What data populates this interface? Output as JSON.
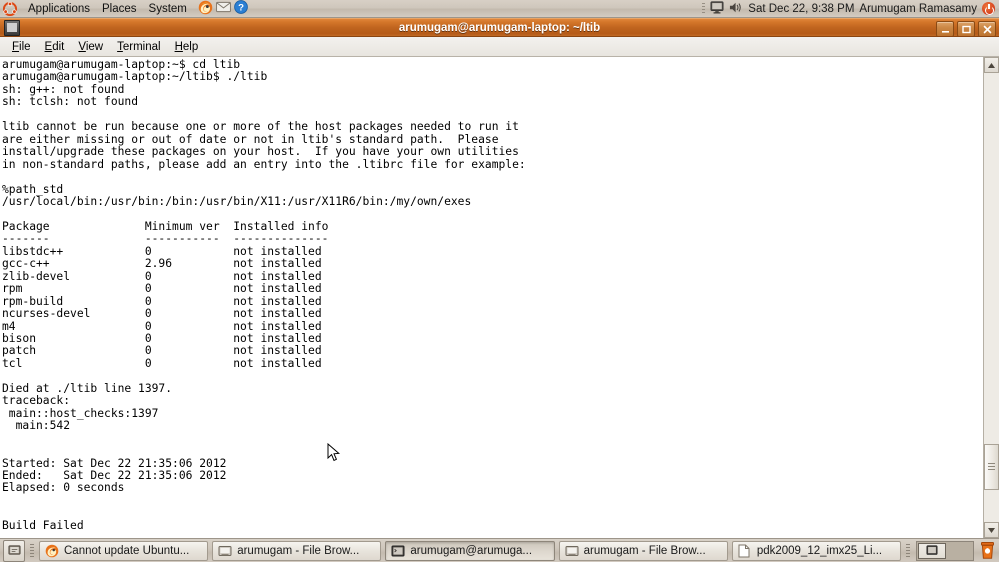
{
  "top_panel": {
    "logo_icon": "ubuntu-logo-icon",
    "menus": [
      "Applications",
      "Places",
      "System"
    ],
    "launchers": [
      {
        "name": "firefox-icon",
        "label": "Firefox Web Browser"
      },
      {
        "name": "evolution-mail-icon",
        "label": "Evolution Mail"
      },
      {
        "name": "help-icon",
        "label": "Help"
      }
    ],
    "tray": {
      "separator_icon": "panel-grip-icon",
      "display_icon": "display-icon",
      "volume_icon": "volume-icon",
      "clock": "Sat Dec 22,  9:38 PM",
      "user": "Arumugam Ramasamy",
      "power_icon": "power-shutdown-icon"
    }
  },
  "window": {
    "icon": "terminal-window-icon",
    "title": "arumugam@arumugam-laptop: ~/ltib",
    "buttons": {
      "minimize": "minimize-icon",
      "maximize": "maximize-icon",
      "close": "close-icon"
    },
    "menubar": [
      {
        "label": "File",
        "accel": "F",
        "rest": "ile"
      },
      {
        "label": "Edit",
        "accel": "E",
        "rest": "dit"
      },
      {
        "label": "View",
        "accel": "V",
        "rest": "iew"
      },
      {
        "label": "Terminal",
        "accel": "T",
        "rest": "erminal"
      },
      {
        "label": "Help",
        "accel": "H",
        "rest": "elp"
      }
    ]
  },
  "terminal": {
    "content": "arumugam@arumugam-laptop:~$ cd ltib\narumugam@arumugam-laptop:~/ltib$ ./ltib\nsh: g++: not found\nsh: tclsh: not found\n\nltib cannot be run because one or more of the host packages needed to run it\nare either missing or out of date or not in ltib's standard path.  Please\ninstall/upgrade these packages on your host.  If you have your own utilities\nin non-standard paths, please add an entry into the .ltibrc file for example:\n\n%path_std\n/usr/local/bin:/usr/bin:/bin:/usr/bin/X11:/usr/X11R6/bin:/my/own/exes\n\nPackage              Minimum ver  Installed info\n-------              -----------  --------------\nlibstdc++            0            not installed\ngcc-c++              2.96         not installed\nzlib-devel           0            not installed\nrpm                  0            not installed\nrpm-build            0            not installed\nncurses-devel        0            not installed\nm4                   0            not installed\nbison                0            not installed\npatch                0            not installed\ntcl                  0            not installed\n\nDied at ./ltib line 1397.\ntraceback:\n main::host_checks:1397\n  main:542\n\n\nStarted: Sat Dec 22 21:35:06 2012\nEnded:   Sat Dec 22 21:35:06 2012\nElapsed: 0 seconds\n\n\nBuild Failed",
    "scrollbar": {
      "up_icon": "scroll-up-arrow-icon",
      "down_icon": "scroll-down-arrow-icon",
      "thumb_icon": "scroll-thumb-grip"
    },
    "cursor_icon": "mouse-pointer-icon"
  },
  "bottom_panel": {
    "show_desktop_icon": "show-desktop-icon",
    "grip_icon": "panel-grip-icon",
    "tasks": [
      {
        "label": "Cannot update Ubuntu...",
        "icon": "firefox-icon",
        "active": false
      },
      {
        "label": "arumugam - File Brow...",
        "icon": "file-browser-icon",
        "active": false
      },
      {
        "label": "arumugam@arumuga...",
        "icon": "terminal-icon",
        "active": true
      },
      {
        "label": "arumugam - File Brow...",
        "icon": "file-browser-icon",
        "active": false
      },
      {
        "label": "pdk2009_12_imx25_Li...",
        "icon": "document-icon",
        "active": false
      }
    ],
    "workspace_switcher": {
      "name": "workspace-switcher",
      "count": 2,
      "active_index": 0
    },
    "trash_icon": "trash-icon"
  },
  "colors": {
    "titlebar": "#c0651f",
    "panel": "#cfc7bc",
    "terminal_bg": "#ffffff",
    "terminal_fg": "#000000",
    "accent_orange": "#dd4814"
  }
}
